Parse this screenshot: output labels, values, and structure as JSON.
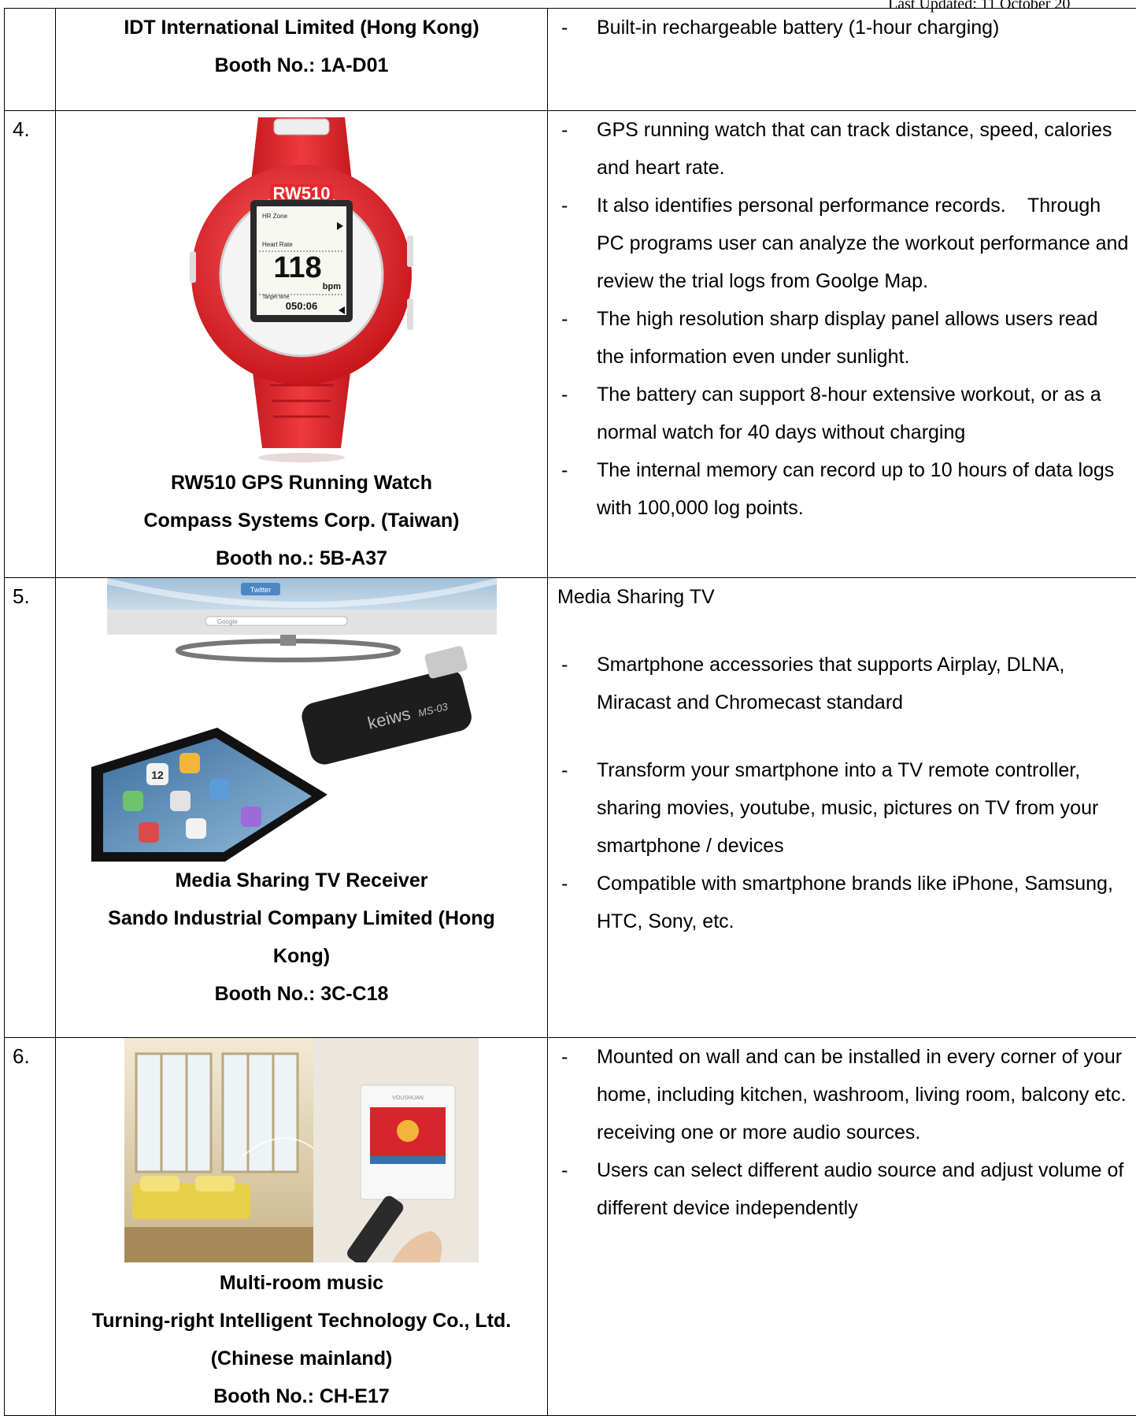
{
  "header": {
    "last_updated": "Last Updated: 11 October 20"
  },
  "rows": [
    {
      "number": "",
      "captions": [
        "IDT International Limited (Hong Kong)",
        "Booth No.: 1A-D01"
      ],
      "bullets": [
        "Built-in rechargeable battery (1-hour charging)"
      ]
    },
    {
      "number": "4.",
      "image": {
        "model_text": "RW510",
        "screen_label_1": "HR Zone",
        "screen_label_2": "Heart Rate",
        "heart_rate": "118",
        "unit": "bpm",
        "screen_label_3": "Target time",
        "time": "050:06"
      },
      "captions": [
        "RW510 GPS Running Watch",
        "Compass Systems Corp. (Taiwan)",
        "Booth no.: 5B-A37"
      ],
      "bullets": [
        "GPS running watch that can track distance, speed, calories and heart rate.",
        "It also identifies personal performance records.    Through PC programs user can analyze the workout performance and review the trial logs from Goolge Map.",
        "The high resolution sharp display panel allows users read the information even under sunlight.",
        "The battery can support 8-hour extensive workout, or as a normal watch for 40 days without charging",
        "The internal memory can record up to 10 hours of data logs with 100,000 log points."
      ]
    },
    {
      "number": "5.",
      "image": {
        "tv_label": "Twitter",
        "search_label": "Google",
        "dongle_brand": "keiws",
        "dongle_model": "MS-03",
        "app_day": "12"
      },
      "captions": [
        "Media Sharing TV Receiver",
        "Sando Industrial Company Limited (Hong Kong)",
        "Booth No.: 3C-C18"
      ],
      "title": "Media Sharing TV",
      "bullets": [
        "Smartphone accessories that supports Airplay, DLNA, Miracast and Chromecast standard",
        "Transform your smartphone into a TV remote controller, sharing movies, youtube, music, pictures on TV from your smartphone / devices",
        "Compatible with smartphone brands like iPhone, Samsung, HTC, Sony, etc."
      ]
    },
    {
      "number": "6.",
      "image": {
        "panel_brand": "VOUSHUAN"
      },
      "captions": [
        "Multi-room music",
        "Turning-right Intelligent Technology Co., Ltd. (Chinese mainland)",
        "Booth No.: CH-E17"
      ],
      "bullets": [
        "Mounted on wall and can be installed in every corner of your home, including kitchen, washroom, living room, balcony etc. receiving one or more audio sources.",
        "Users can select different audio source and adjust volume of different device independently"
      ]
    }
  ],
  "colors": {
    "watch_red": "#e8262b",
    "border": "#000000"
  }
}
